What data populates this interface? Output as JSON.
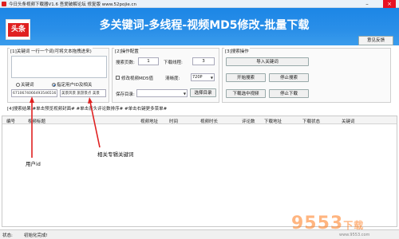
{
  "window": {
    "title": "今日头条视频下载器V1.6 吾爱破解论坛 修复版  www.52pojie.cn"
  },
  "header": {
    "logo_text": "头条",
    "title": "多关键词-多线程-视频MD5修改-批量下载",
    "feedback_label": "意见反馈"
  },
  "keywords_panel": {
    "title": "[1]关键词 一行一个词(可将文本拖拽进来)",
    "mode_keyword": "关键词",
    "mode_user": "指定用户ID及相关",
    "user_id_value": "6710674066493546516",
    "related_value": "美景风景 旅游景点 美景"
  },
  "config_panel": {
    "title": "[2]操作配置",
    "pages_label": "搜索页数:",
    "pages_value": "1",
    "threads_label": "下载线程:",
    "threads_value": "3",
    "md5_label": "修改视频MD5值",
    "quality_label": "清晰度:",
    "quality_value": "720P",
    "save_label": "保存目录:",
    "save_button": "选择目录"
  },
  "search_panel": {
    "title": "[3]搜索操作",
    "import_keywords": "导入关键词",
    "start_search": "开始搜索",
    "stop_search": "停止搜索",
    "download_selected": "下载选中视频",
    "stop_download": "停止下载"
  },
  "results_tabs": {
    "text": "[4]搜索结果  #单击预览视频封面#  #单击表头评论数排序#  #单击右键更多菜单#"
  },
  "table": {
    "columns": [
      "编号",
      "视频标题",
      "视频地址",
      "时间",
      "视频时长",
      "评论数",
      "下载地址",
      "下载状态",
      "关键词"
    ]
  },
  "annotations": {
    "user_id": "用户id",
    "related": "相关专辑关键词"
  },
  "status": {
    "label": "状态:",
    "message": "初始化完成!"
  },
  "watermark": {
    "text": "9553",
    "suffix": "下载",
    "url": "www.9553.com"
  },
  "colors": {
    "header_blue": "#1c86e6",
    "logo_red": "#e02020",
    "arrow_red": "#e02020"
  }
}
